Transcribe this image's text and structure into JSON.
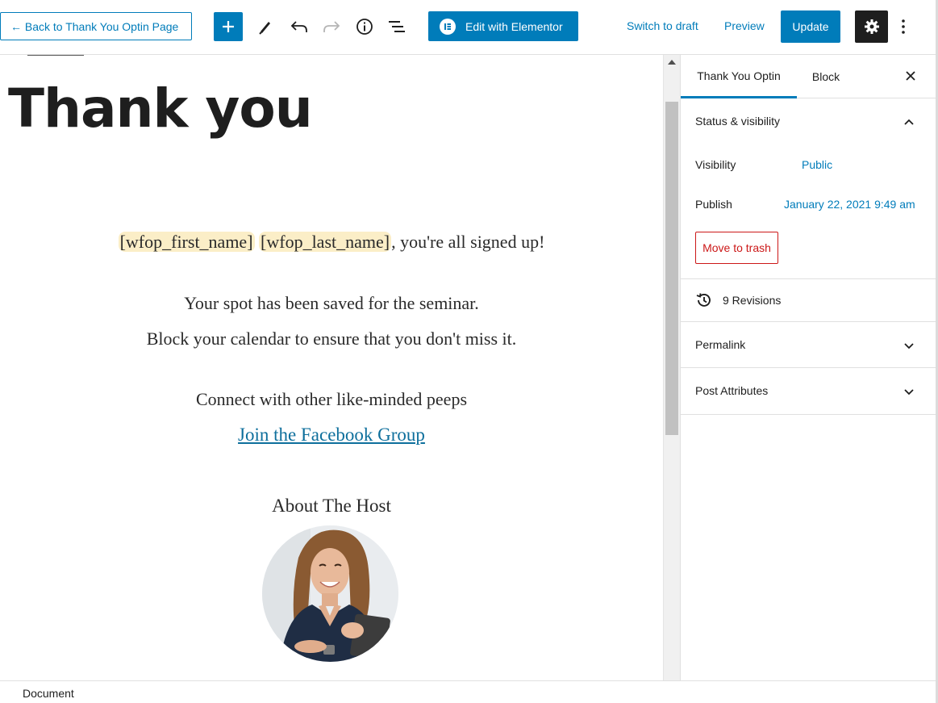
{
  "toolbar": {
    "back_label": "← Back to Thank You Optin Page",
    "elementor_label": "Edit with Elementor",
    "switch_draft_label": "Switch to draft",
    "preview_label": "Preview",
    "update_label": "Update",
    "icons": [
      "plus-icon",
      "pencil-icon",
      "undo-icon",
      "redo-icon",
      "info-icon",
      "list-view-icon",
      "elementor-icon",
      "gear-icon",
      "more-vertical-icon"
    ],
    "accent_color": "#007cba"
  },
  "editor": {
    "title": "Thank you",
    "tag_first": "[wfop_first_name]",
    "tag_last": "[wfop_last_name]",
    "signup_suffix": ", you're all signed up!",
    "spot_line": "Your spot has been saved for the seminar.",
    "block_line": "Block your calendar to ensure that you don't miss it.",
    "connect_line": "Connect with other like-minded peeps",
    "facebook_link": "Join the Facebook Group",
    "host_heading": "About The Host"
  },
  "sidebar": {
    "tabs": [
      {
        "label": "Thank You Optin",
        "active": true
      },
      {
        "label": "Block",
        "active": false
      }
    ],
    "status_visibility": {
      "heading": "Status & visibility",
      "expanded": true,
      "visibility_label": "Visibility",
      "visibility_value": "Public",
      "publish_label": "Publish",
      "publish_value": "January 22, 2021 9:49 am",
      "trash_label": "Move to trash"
    },
    "revisions_label": "9 Revisions",
    "permalink_heading": "Permalink",
    "post_attributes_heading": "Post Attributes"
  },
  "footer": {
    "breadcrumb": "Document"
  }
}
